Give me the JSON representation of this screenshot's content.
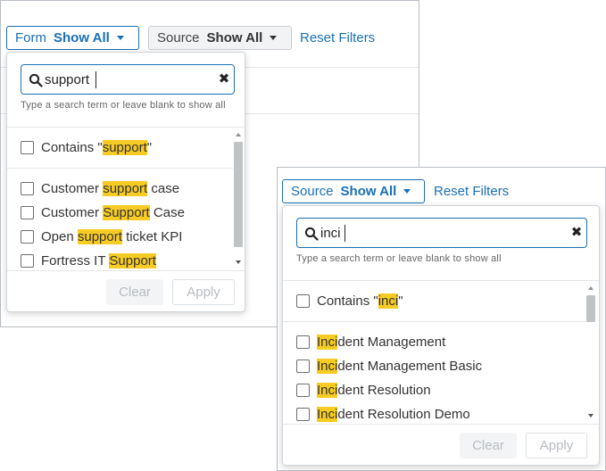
{
  "left": {
    "form_filter": {
      "label": "Form",
      "value": "Show All"
    },
    "source_filter": {
      "label": "Source",
      "value": "Show All"
    },
    "reset_label": "Reset Filters",
    "dropdown": {
      "search_value": "support",
      "hint": "Type a search term or leave blank to show all",
      "contains": {
        "prefix": "Contains \"",
        "match": "support",
        "suffix": "\""
      },
      "options": [
        {
          "before": "Customer ",
          "match": "support",
          "after": " case"
        },
        {
          "before": "Customer ",
          "match": "Support",
          "after": " Case"
        },
        {
          "before": "Open ",
          "match": "support",
          "after": " ticket KPI"
        },
        {
          "before": "Fortress IT ",
          "match": "Support",
          "after": ""
        }
      ],
      "clear_label": "Clear",
      "apply_label": "Apply"
    }
  },
  "right": {
    "source_filter": {
      "label": "Source",
      "value": "Show All"
    },
    "reset_label": "Reset Filters",
    "dropdown": {
      "search_value": "inci",
      "hint": "Type a search term or leave blank to show all",
      "contains": {
        "prefix": "Contains \"",
        "match": "inci",
        "suffix": "\""
      },
      "options": [
        {
          "before": "",
          "match": "Inci",
          "after": "dent Management"
        },
        {
          "before": "",
          "match": "Inci",
          "after": "dent Management Basic"
        },
        {
          "before": "",
          "match": "Inci",
          "after": "dent Resolution"
        },
        {
          "before": "",
          "match": "Inci",
          "after": "dent Resolution Demo"
        }
      ],
      "clear_label": "Clear",
      "apply_label": "Apply"
    }
  },
  "colors": {
    "accent": "#1a6fb5",
    "highlight": "#f6cb23",
    "border": "#b9bec4"
  },
  "icons": {
    "search": "search-icon",
    "clear": "close-icon",
    "dropdown": "chevron-down-icon"
  }
}
